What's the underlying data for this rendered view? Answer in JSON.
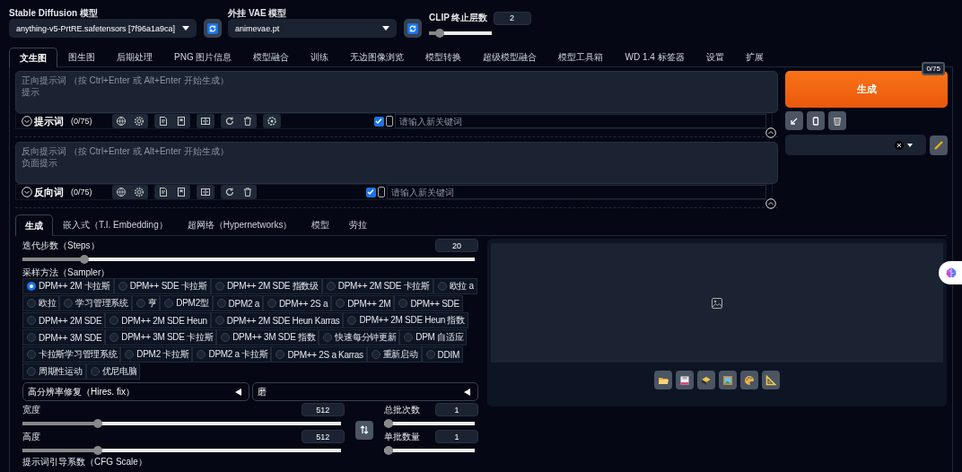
{
  "model_select": {
    "label": "Stable Diffusion 模型",
    "value": "anything-v5-PrtRE.safetensors [7f96a1a9ca]"
  },
  "vae_select": {
    "label": "外挂 VAE 模型",
    "value": "animevae.pt"
  },
  "clip_skip": {
    "label": "CLIP 终止层数",
    "value": "2",
    "level": 0.12
  },
  "tabs": [
    {
      "label": "文生图",
      "selected": true
    },
    {
      "label": "图生图",
      "selected": false
    },
    {
      "label": "后期处理",
      "selected": false
    },
    {
      "label": "PNG 图片信息",
      "selected": false
    },
    {
      "label": "模型融合",
      "selected": false
    },
    {
      "label": "训练",
      "selected": false
    },
    {
      "label": "无边图像浏览",
      "selected": false
    },
    {
      "label": "模型转换",
      "selected": false
    },
    {
      "label": "超级模型融合",
      "selected": false
    },
    {
      "label": "模型工具箱",
      "selected": false
    },
    {
      "label": "WD 1.4 标签器",
      "selected": false
    },
    {
      "label": "设置",
      "selected": false
    },
    {
      "label": "扩展",
      "selected": false
    }
  ],
  "prompts": [
    {
      "placeholder": "正向提示词 （按 Ctrl+Enter 或 Alt+Enter 开始生成）",
      "hint": "提示",
      "title": "提示词",
      "count": "(0/75)",
      "extra_button": true,
      "keyword_checked": true,
      "keyword_placeholder": "请输入新关键词"
    },
    {
      "placeholder": "反向提示词 （按 Ctrl+Enter 或 Alt+Enter 开始生成）",
      "hint": "负面提示",
      "title": "反向词",
      "count": "(0/75)",
      "extra_button": false,
      "keyword_checked": true,
      "keyword_placeholder": "请输入新关键词"
    }
  ],
  "generate": {
    "label": "生成",
    "token_count": "0/75"
  },
  "subtabs": [
    {
      "label": "生成",
      "selected": true
    },
    {
      "label": "嵌入式（T.I. Embedding）",
      "selected": false
    },
    {
      "label": "超网络（Hypernetworks）",
      "selected": false
    },
    {
      "label": "模型",
      "selected": false
    },
    {
      "label": "劳拉",
      "selected": false
    }
  ],
  "steps": {
    "label": "迭代步数（Steps）",
    "value": "20",
    "level": 0.13
  },
  "sampler": {
    "label": "采样方法（Sampler）",
    "options": [
      {
        "label": "DPM++ 2M 卡拉斯",
        "selected": true
      },
      {
        "label": "DPM++ SDE 卡拉斯",
        "selected": false
      },
      {
        "label": "DPM++ 2M SDE 指数级",
        "selected": false
      },
      {
        "label": "DPM++ 2M SDE 卡拉斯",
        "selected": false
      },
      {
        "label": "欧拉 a",
        "selected": false
      },
      {
        "label": "欧拉",
        "selected": false
      },
      {
        "label": "学习管理系统",
        "selected": false
      },
      {
        "label": "亨",
        "selected": false
      },
      {
        "label": "DPM2型",
        "selected": false
      },
      {
        "label": "DPM2 a",
        "selected": false
      },
      {
        "label": "DPM++ 2S a",
        "selected": false
      },
      {
        "label": "DPM++ 2M",
        "selected": false
      },
      {
        "label": "DPM++ SDE",
        "selected": false
      },
      {
        "label": "DPM++ 2M SDE",
        "selected": false
      },
      {
        "label": "DPM++ 2M SDE Heun",
        "selected": false
      },
      {
        "label": "DPM++ 2M SDE Heun Karras",
        "selected": false
      },
      {
        "label": "DPM++ 2M SDE Heun 指数",
        "selected": false
      },
      {
        "label": "DPM++ 3M SDE",
        "selected": false
      },
      {
        "label": "DPM++ 3M SDE 卡拉斯",
        "selected": false
      },
      {
        "label": "DPM++ 3M SDE 指数",
        "selected": false
      },
      {
        "label": "快速每分钟更新",
        "selected": false
      },
      {
        "label": "DPM 自适应",
        "selected": false
      },
      {
        "label": "卡拉斯学习管理系统",
        "selected": false
      },
      {
        "label": "DPM2 卡拉斯",
        "selected": false
      },
      {
        "label": "DPM2 a 卡拉斯",
        "selected": false
      },
      {
        "label": "DPM++ 2S a Karras",
        "selected": false
      },
      {
        "label": "重新启动",
        "selected": false
      },
      {
        "label": "DDIM",
        "selected": false
      },
      {
        "label": "周期性运动",
        "selected": false
      },
      {
        "label": "优尼电脑",
        "selected": false
      }
    ]
  },
  "accordions": [
    {
      "label": "高分辨率修复（Hires. fix）",
      "expanded": false
    },
    {
      "label": "磨",
      "expanded": false
    }
  ],
  "width": {
    "label": "宽度",
    "value": "512",
    "level": 0.23
  },
  "height": {
    "label": "高度",
    "value": "512",
    "level": 0.23
  },
  "batch_count": {
    "label": "总批次数",
    "value": "1",
    "level": 0
  },
  "batch_size": {
    "label": "单批数量",
    "value": "1",
    "level": 0
  },
  "cfg_label": "提示词引导系数（CFG Scale）"
}
